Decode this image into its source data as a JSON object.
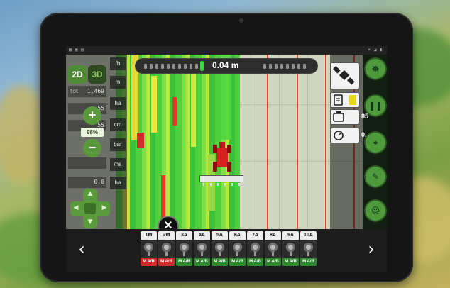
{
  "colors": {
    "accent_green": "#4f9a3c",
    "covered_green": "#4fd13b",
    "guide_red": "#e2472a",
    "section_manual_red": "#d12a2a",
    "section_auto_green": "#2c8a2c"
  },
  "speed_bar": {
    "offset": "0.04 m"
  },
  "left_panel": {
    "view_2d": "2D",
    "view_3d": "3D",
    "zoom_in": "+",
    "zoom_out": "−",
    "zoom_level": "98%",
    "units": [
      "/h",
      "m",
      "ha",
      "cm",
      "bar",
      "/ha",
      "ha"
    ],
    "stats": [
      {
        "label": "tot",
        "value": "1,469"
      },
      {
        "label": "",
        "value": "55"
      },
      {
        "label": "",
        "value": "55"
      },
      {
        "label": "",
        "value": ""
      },
      {
        "label": "",
        "value": "0.0"
      }
    ],
    "dpad_arrows": {
      "up": "▲",
      "down": "▼",
      "left": "◀",
      "right": "▶"
    }
  },
  "right_panel": {
    "values": [
      "",
      "",
      "85",
      "0."
    ],
    "icons": [
      "satellite-icon",
      "document-icon",
      "tank-icon",
      "gauge-icon"
    ],
    "buttons": [
      {
        "icon": "sprayer-icon",
        "glyph": "⛯"
      },
      {
        "icon": "pause-icon",
        "glyph": "❚❚"
      },
      {
        "icon": "map-marker-icon",
        "glyph": "⌖"
      },
      {
        "icon": "nozzle-icon",
        "glyph": "✎"
      },
      {
        "icon": "operator-icon",
        "glyph": "☺"
      }
    ]
  },
  "close_glyph": "✕",
  "sections": [
    {
      "name": "1M",
      "mode": "M A/B",
      "state": "manual"
    },
    {
      "name": "2M",
      "mode": "M A/B",
      "state": "manual"
    },
    {
      "name": "3A",
      "mode": "M A/B",
      "state": "auto"
    },
    {
      "name": "4A",
      "mode": "M A/B",
      "state": "auto"
    },
    {
      "name": "5A",
      "mode": "M A/B",
      "state": "auto"
    },
    {
      "name": "6A",
      "mode": "M A/B",
      "state": "auto"
    },
    {
      "name": "7A",
      "mode": "M A/B",
      "state": "auto"
    },
    {
      "name": "8A",
      "mode": "M A/B",
      "state": "auto"
    },
    {
      "name": "9A",
      "mode": "M A/B",
      "state": "auto"
    },
    {
      "name": "10A",
      "mode": "M A/B",
      "state": "auto"
    }
  ],
  "bottom_nav": {
    "prev": "‹",
    "next": "›"
  }
}
